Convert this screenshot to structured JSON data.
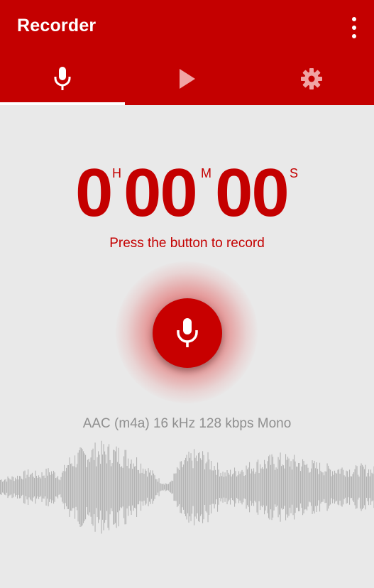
{
  "app": {
    "title": "Recorder",
    "accent_color": "#c40000"
  },
  "tabs": [
    {
      "icon": "microphone-icon",
      "selected": true
    },
    {
      "icon": "play-icon",
      "selected": false
    },
    {
      "icon": "settings-gear-icon",
      "selected": false
    }
  ],
  "timer": {
    "hours": "0",
    "hours_unit": "H",
    "minutes": "00",
    "minutes_unit": "M",
    "seconds": "00",
    "seconds_unit": "S"
  },
  "hint": "Press the button to record",
  "record_button": {
    "icon": "microphone-icon"
  },
  "format_info": "AAC (m4a) 16 kHz 128 kbps Mono",
  "menu": {
    "icon": "more-vert-icon"
  }
}
